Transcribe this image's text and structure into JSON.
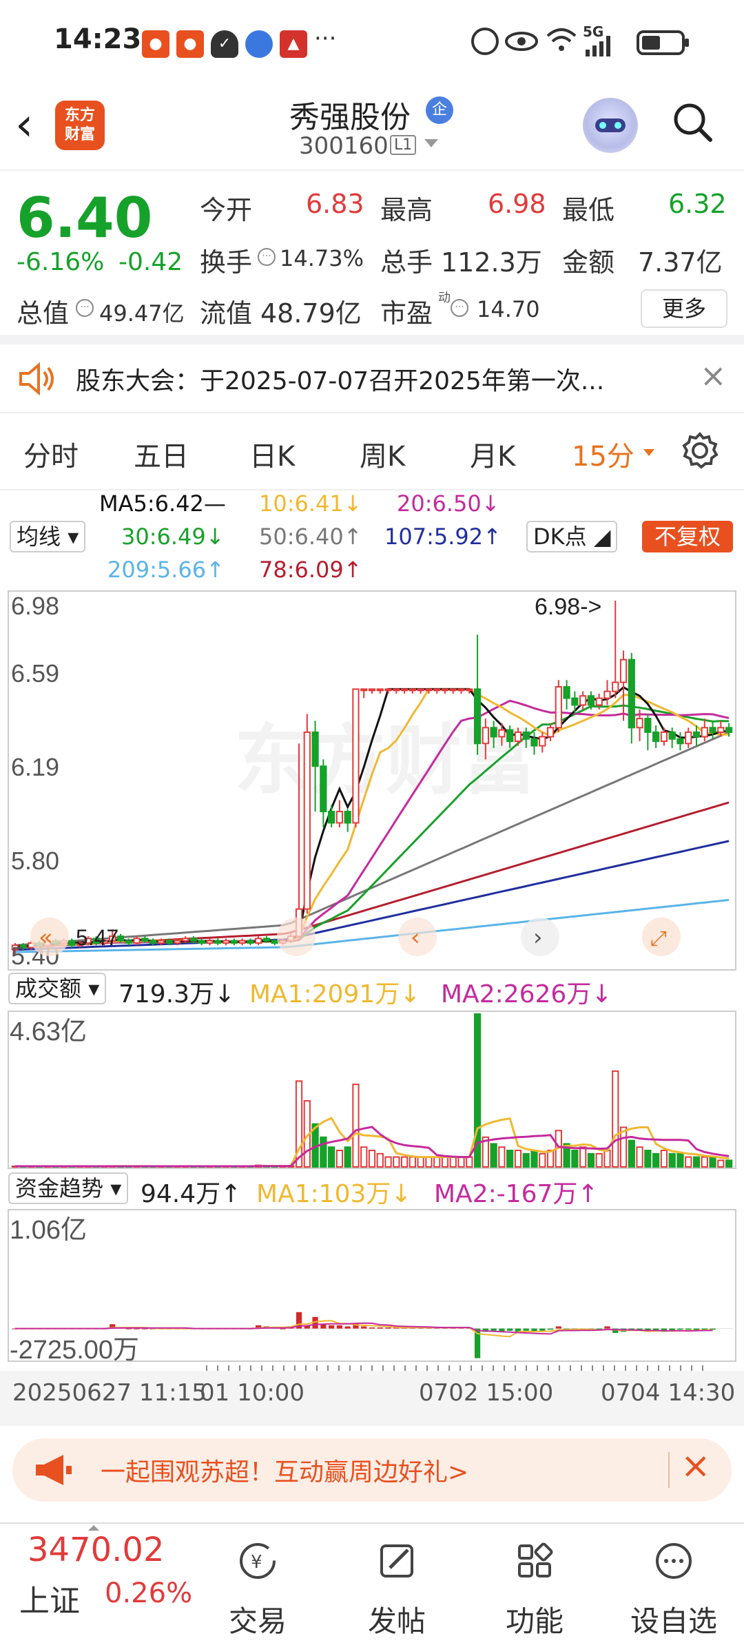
{
  "status_bar": {
    "time": "14:23",
    "signal": "5G"
  },
  "header": {
    "stock_name": "秀强股份",
    "stock_code": "300160",
    "level_badge": "L1",
    "logo_text": [
      "东方",
      "财富"
    ],
    "badge_icon": "企"
  },
  "quote": {
    "price": "6.40",
    "change_pct": "-6.16%",
    "change": "-0.42",
    "open_label": "今开",
    "open": "6.83",
    "high_label": "最高",
    "high": "6.98",
    "low_label": "最低",
    "low": "6.32",
    "turnover_label": "换手",
    "turnover": "14.73%",
    "volume_label": "总手",
    "volume": "112.3万",
    "amount_label": "金额",
    "amount": "7.37亿",
    "mktcap_label": "总值",
    "mktcap": "49.47亿",
    "float_label": "流值",
    "float": "48.79亿",
    "pe_label": "市盈",
    "pe_sup": "动",
    "pe": "14.70",
    "more": "更多"
  },
  "notice": {
    "text": "股东大会：于2025-07-07召开2025年第一次..."
  },
  "tabs": [
    "分时",
    "五日",
    "日K",
    "周K",
    "月K",
    "15分"
  ],
  "ma_bar": {
    "selector": "均线",
    "ma5": "MA5:6.42—",
    "ma10": "10:6.41↓",
    "ma20": "20:6.50↓",
    "ma30": "30:6.49↓",
    "ma50": "50:6.40↑",
    "ma107": "107:5.92↑",
    "ma209": "209:5.66↑",
    "ma78": "78:6.09↑",
    "dk": "DK点",
    "fq": "不复权"
  },
  "colors": {
    "up": "#e23a3a",
    "down": "#16a12a",
    "accent": "#e8721f",
    "ma5": "#111111",
    "ma10": "#f0b830",
    "ma20": "#c42a9c",
    "ma30": "#18a02a",
    "ma50": "#777777",
    "ma78": "#b41e2e",
    "ma107": "#1f2e9e",
    "ma209": "#5ab4e8"
  },
  "price_axis": {
    "labels": [
      "6.98",
      "6.59",
      "6.19",
      "5.80",
      "5.40"
    ],
    "high_mark": "6.98->",
    "low_mark": "5.47"
  },
  "volume_panel": {
    "selector": "成交额",
    "value": "719.3万↓",
    "ma1": "MA1:2091万↓",
    "ma2": "MA2:2626万↓",
    "max": "4.63亿"
  },
  "flow_panel": {
    "selector": "资金趋势",
    "value": "94.4万↑",
    "ma1": "MA1:103万↓",
    "ma2": "MA2:-167万↑",
    "max": "1.06亿",
    "min": "-2725.00万"
  },
  "time_axis": {
    "left": "20250627 11:15",
    "left2": "01 10:00",
    "mid": "0702 15:00",
    "right": "0704 14:30"
  },
  "chart_data": {
    "type": "candlestick",
    "ylim": [
      5.4,
      6.98
    ],
    "candles": [
      [
        5.44,
        5.46,
        5.42,
        5.47
      ],
      [
        5.46,
        5.45,
        5.44,
        5.47
      ],
      [
        5.45,
        5.47,
        5.44,
        5.48
      ],
      [
        5.47,
        5.46,
        5.45,
        5.48
      ],
      [
        5.46,
        5.48,
        5.45,
        5.49
      ],
      [
        5.48,
        5.47,
        5.46,
        5.49
      ],
      [
        5.47,
        5.48,
        5.46,
        5.49
      ],
      [
        5.48,
        5.46,
        5.45,
        5.49
      ],
      [
        5.46,
        5.47,
        5.45,
        5.48
      ],
      [
        5.47,
        5.49,
        5.46,
        5.5
      ],
      [
        5.49,
        5.47,
        5.46,
        5.5
      ],
      [
        5.47,
        5.48,
        5.46,
        5.49
      ],
      [
        5.48,
        5.5,
        5.47,
        5.53
      ],
      [
        5.5,
        5.48,
        5.47,
        5.51
      ],
      [
        5.48,
        5.47,
        5.46,
        5.49
      ],
      [
        5.47,
        5.49,
        5.46,
        5.5
      ],
      [
        5.49,
        5.48,
        5.47,
        5.5
      ],
      [
        5.48,
        5.47,
        5.46,
        5.49
      ],
      [
        5.47,
        5.48,
        5.46,
        5.49
      ],
      [
        5.48,
        5.47,
        5.46,
        5.49
      ],
      [
        5.47,
        5.48,
        5.46,
        5.49
      ],
      [
        5.48,
        5.49,
        5.47,
        5.5
      ],
      [
        5.49,
        5.48,
        5.47,
        5.5
      ],
      [
        5.48,
        5.47,
        5.46,
        5.49
      ],
      [
        5.47,
        5.48,
        5.46,
        5.49
      ],
      [
        5.48,
        5.47,
        5.46,
        5.49
      ],
      [
        5.47,
        5.48,
        5.46,
        5.49
      ],
      [
        5.48,
        5.47,
        5.46,
        5.49
      ],
      [
        5.47,
        5.48,
        5.46,
        5.49
      ],
      [
        5.48,
        5.47,
        5.46,
        5.49
      ],
      [
        5.47,
        5.49,
        5.46,
        5.5
      ],
      [
        5.49,
        5.48,
        5.47,
        5.5
      ],
      [
        5.48,
        5.47,
        5.46,
        5.49
      ],
      [
        5.47,
        5.48,
        5.46,
        5.49
      ],
      [
        5.48,
        5.5,
        5.47,
        5.51
      ],
      [
        5.5,
        5.62,
        5.49,
        6.35
      ],
      [
        5.62,
        6.4,
        5.6,
        6.48
      ],
      [
        6.4,
        6.25,
        6.05,
        6.45
      ],
      [
        6.25,
        6.05,
        5.98,
        6.28
      ],
      [
        6.05,
        6.0,
        5.98,
        6.08
      ],
      [
        6.0,
        6.05,
        5.98,
        6.1
      ],
      [
        6.05,
        6.0,
        5.96,
        6.06
      ],
      [
        6.0,
        6.59,
        5.98,
        6.59
      ],
      [
        6.59,
        6.59,
        6.55,
        6.59
      ],
      [
        6.59,
        6.59,
        6.57,
        6.59
      ],
      [
        6.59,
        6.59,
        6.57,
        6.59
      ],
      [
        6.59,
        6.59,
        6.57,
        6.59
      ],
      [
        6.59,
        6.59,
        6.57,
        6.59
      ],
      [
        6.59,
        6.59,
        6.57,
        6.59
      ],
      [
        6.59,
        6.59,
        6.57,
        6.59
      ],
      [
        6.59,
        6.59,
        6.57,
        6.59
      ],
      [
        6.59,
        6.59,
        6.57,
        6.59
      ],
      [
        6.59,
        6.59,
        6.57,
        6.59
      ],
      [
        6.59,
        6.59,
        6.57,
        6.59
      ],
      [
        6.59,
        6.59,
        6.57,
        6.59
      ],
      [
        6.59,
        6.59,
        6.57,
        6.59
      ],
      [
        6.59,
        6.59,
        6.57,
        6.59
      ],
      [
        6.59,
        6.35,
        6.3,
        6.83
      ],
      [
        6.35,
        6.42,
        6.28,
        6.46
      ],
      [
        6.42,
        6.38,
        6.33,
        6.45
      ],
      [
        6.38,
        6.41,
        6.34,
        6.44
      ],
      [
        6.41,
        6.36,
        6.33,
        6.43
      ],
      [
        6.36,
        6.4,
        6.34,
        6.42
      ],
      [
        6.4,
        6.37,
        6.33,
        6.42
      ],
      [
        6.37,
        6.34,
        6.3,
        6.4
      ],
      [
        6.34,
        6.38,
        6.31,
        6.4
      ],
      [
        6.38,
        6.42,
        6.36,
        6.44
      ],
      [
        6.42,
        6.6,
        6.4,
        6.63
      ],
      [
        6.6,
        6.55,
        6.5,
        6.63
      ],
      [
        6.55,
        6.52,
        6.48,
        6.58
      ],
      [
        6.52,
        6.56,
        6.5,
        6.58
      ],
      [
        6.56,
        6.52,
        6.5,
        6.58
      ],
      [
        6.52,
        6.55,
        6.5,
        6.57
      ],
      [
        6.55,
        6.58,
        6.52,
        6.63
      ],
      [
        6.58,
        6.62,
        6.55,
        6.98
      ],
      [
        6.62,
        6.72,
        6.45,
        6.76
      ],
      [
        6.72,
        6.42,
        6.35,
        6.75
      ],
      [
        6.42,
        6.46,
        6.36,
        6.5
      ],
      [
        6.46,
        6.4,
        6.32,
        6.48
      ],
      [
        6.4,
        6.36,
        6.33,
        6.43
      ],
      [
        6.36,
        6.4,
        6.34,
        6.42
      ],
      [
        6.4,
        6.37,
        6.33,
        6.42
      ],
      [
        6.37,
        6.35,
        6.32,
        6.4
      ],
      [
        6.35,
        6.4,
        6.33,
        6.42
      ],
      [
        6.4,
        6.38,
        6.34,
        6.43
      ],
      [
        6.38,
        6.42,
        6.36,
        6.46
      ],
      [
        6.42,
        6.4,
        6.37,
        6.45
      ],
      [
        6.4,
        6.42,
        6.38,
        6.45
      ],
      [
        6.42,
        6.4,
        6.38,
        6.44
      ]
    ],
    "volume": [
      0.02,
      0.02,
      0.02,
      0.02,
      0.02,
      0.02,
      0.02,
      0.02,
      0.02,
      0.02,
      0.02,
      0.02,
      0.03,
      0.02,
      0.02,
      0.02,
      0.02,
      0.02,
      0.02,
      0.02,
      0.02,
      0.02,
      0.02,
      0.02,
      0.02,
      0.02,
      0.02,
      0.02,
      0.02,
      0.02,
      0.05,
      0.04,
      0.03,
      0.02,
      0.03,
      2.6,
      2.0,
      1.3,
      0.9,
      0.6,
      0.5,
      0.6,
      2.5,
      0.6,
      0.5,
      0.4,
      0.3,
      0.3,
      0.3,
      0.3,
      0.3,
      0.3,
      0.3,
      0.3,
      0.3,
      0.3,
      0.3,
      4.63,
      0.9,
      0.7,
      0.6,
      0.5,
      0.5,
      0.4,
      0.5,
      0.4,
      0.5,
      1.1,
      0.7,
      0.5,
      0.6,
      0.4,
      0.4,
      0.5,
      2.9,
      1.2,
      0.8,
      0.6,
      0.5,
      0.4,
      0.5,
      0.4,
      0.4,
      0.3,
      0.3,
      0.3,
      0.3,
      0.2,
      0.2
    ],
    "flow": [
      0,
      0,
      0,
      0,
      0,
      0,
      0,
      0,
      0,
      0,
      0,
      0,
      4,
      1,
      0,
      0,
      0,
      0,
      0,
      0,
      0,
      0,
      0,
      0,
      0,
      0,
      0,
      0,
      0,
      0,
      3,
      2,
      1,
      0,
      2,
      15,
      3,
      10.6,
      4,
      3,
      3,
      2,
      5,
      2,
      1,
      1,
      1,
      1,
      1,
      1,
      1,
      1,
      1,
      1,
      1,
      1,
      1,
      -27,
      -3,
      -2,
      -3,
      -2,
      -4,
      -2,
      -3,
      -2,
      -1,
      2,
      -1,
      -2,
      -1,
      -2,
      -1,
      2,
      -4,
      -3,
      -2,
      -1,
      -3,
      -2,
      -3,
      -2,
      -1,
      -1,
      -2,
      -1,
      -1
    ]
  },
  "promo": {
    "text": "一起围观苏超！互动赢周边好礼>"
  },
  "bottom_nav": {
    "index_value": "3470.02",
    "index_name": "上证",
    "index_change": "0.26%",
    "items": [
      "交易",
      "发帖",
      "功能",
      "设自选"
    ]
  }
}
